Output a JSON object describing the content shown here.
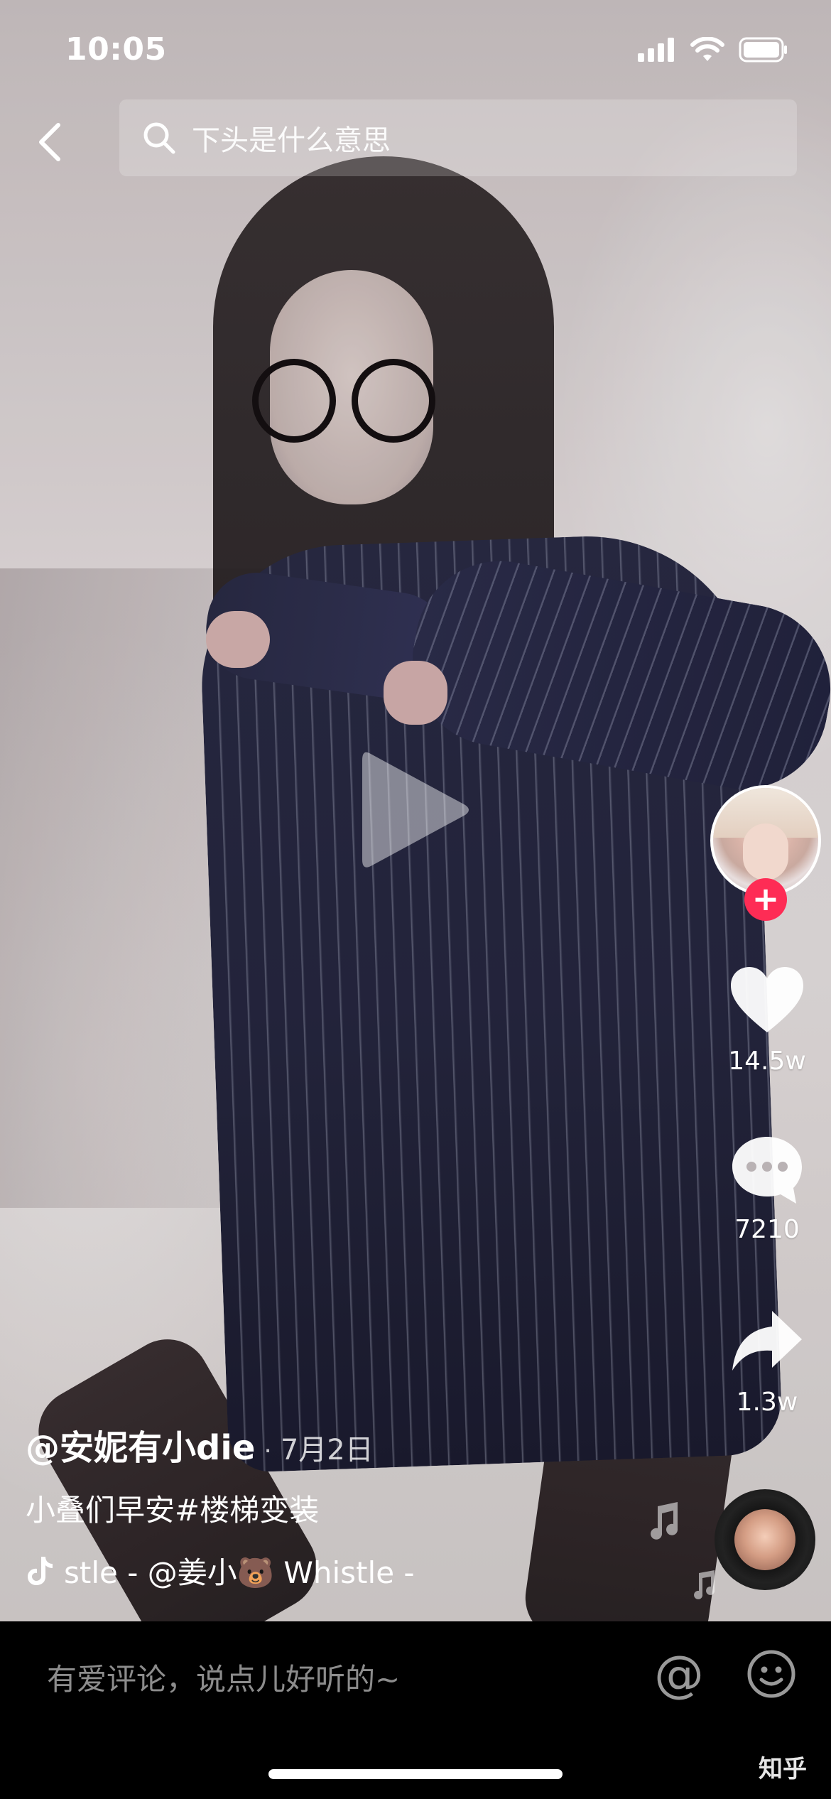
{
  "status_bar": {
    "time": "10:05"
  },
  "search": {
    "query": "下头是什么意思"
  },
  "rail": {
    "likes": "14.5w",
    "comments": "7210",
    "shares": "1.3w",
    "follow_label": "+"
  },
  "caption": {
    "author": "@安妮有小die",
    "separator": "·",
    "date": "7月2日",
    "description": "小叠们早安#楼梯变装",
    "music": "stle - @姜小🐻   Whistle -"
  },
  "bottom": {
    "comment_placeholder": "有爱评论，说点儿好听的~",
    "at_symbol": "@"
  },
  "watermark": "知乎",
  "colors": {
    "accent": "#fe2c55",
    "background": "#000000"
  },
  "icons": [
    "back-icon",
    "search-icon",
    "play-icon",
    "heart-icon",
    "comment-icon",
    "share-icon",
    "music-note-icon",
    "tiktok-icon",
    "emoji-icon"
  ]
}
